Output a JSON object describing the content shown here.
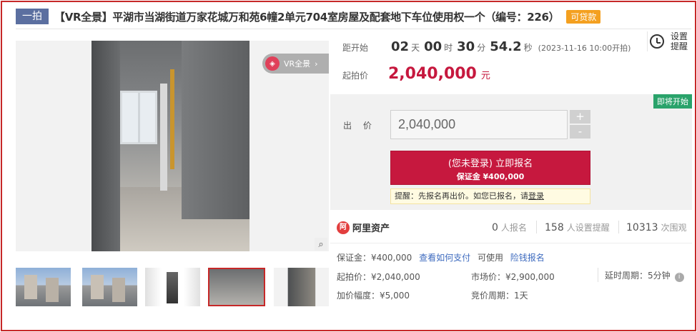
{
  "title": {
    "tag": "一拍",
    "text": "【VR全景】平湖市当湖街道万家花城万和苑6幢2单元704室房屋及配套地下车位使用权一个（编号：226）",
    "loan_tag": "可贷款"
  },
  "gallery": {
    "vr_label": "VR全景",
    "vr_arrow": "›",
    "zoom_icon": "search-icon",
    "active_thumb": 3,
    "thumbs": [
      "building",
      "building",
      "hallway",
      "room",
      "doorway"
    ]
  },
  "countdown": {
    "label": "距开始",
    "days": "02",
    "days_unit": "天",
    "hours": "00",
    "hours_unit": "时",
    "minutes": "30",
    "minutes_unit": "分",
    "seconds": "54.2",
    "seconds_unit": "秒",
    "start_note": "(2023-11-16 10:00开拍)"
  },
  "remind": {
    "line1": "设置",
    "line2": "提醒"
  },
  "start_price": {
    "label": "起拍价",
    "value": "2,040,000",
    "unit": "元"
  },
  "bid": {
    "status_badge": "即将开始",
    "label": "出 价",
    "input_value": "2,040,000",
    "plus": "+",
    "minus": "-",
    "signup_main": "(您未登录) 立即报名",
    "signup_sub": "保证金 ¥400,000",
    "hint_prefix": "提醒：先报名再出价。如您已报名，请",
    "hint_link": "登录"
  },
  "stats": {
    "brand": "阿里资产",
    "brand_mark": "阿",
    "signups": "0",
    "signups_label": "人报名",
    "reminders": "158",
    "reminders_label": "人设置提醒",
    "views": "10313",
    "views_label": "次围观"
  },
  "facts": {
    "deposit": "保证金：¥400,000",
    "how_to_pay": "查看如何支付",
    "available": "可使用",
    "risk_signup": "险钱报名",
    "start_price": "起拍价：¥2,040,000",
    "market_price": "市场价：¥2,900,000",
    "delay_period": "延时周期：5分钟",
    "increment": "加价幅度：¥5,000",
    "bid_cycle": "竞价周期：1天",
    "info_icon": "i"
  }
}
